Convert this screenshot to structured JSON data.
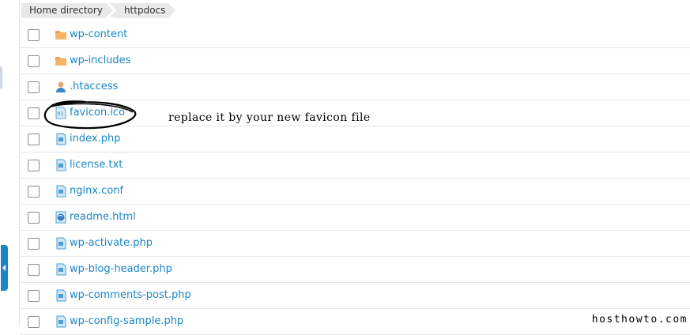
{
  "breadcrumb": [
    "Home directory",
    "httpdocs"
  ],
  "files": [
    {
      "name": "wp-content",
      "icon": "folder-icon"
    },
    {
      "name": "wp-includes",
      "icon": "folder-icon"
    },
    {
      "name": ".htaccess",
      "icon": "user-file-icon"
    },
    {
      "name": "favicon.ico",
      "icon": "binary-file-icon"
    },
    {
      "name": "index.php",
      "icon": "php-file-icon"
    },
    {
      "name": "license.txt",
      "icon": "text-file-icon"
    },
    {
      "name": "nginx.conf",
      "icon": "text-file-icon"
    },
    {
      "name": "readme.html",
      "icon": "html-file-icon"
    },
    {
      "name": "wp-activate.php",
      "icon": "php-file-icon"
    },
    {
      "name": "wp-blog-header.php",
      "icon": "php-file-icon"
    },
    {
      "name": "wp-comments-post.php",
      "icon": "php-file-icon"
    },
    {
      "name": "wp-config-sample.php",
      "icon": "php-file-icon"
    }
  ],
  "annotation": "replace it by your new favicon file",
  "watermark": "hosthowto.com",
  "colors": {
    "link": "#1a86c6",
    "folder": "#f0a04b",
    "handle": "#1e86c8"
  }
}
